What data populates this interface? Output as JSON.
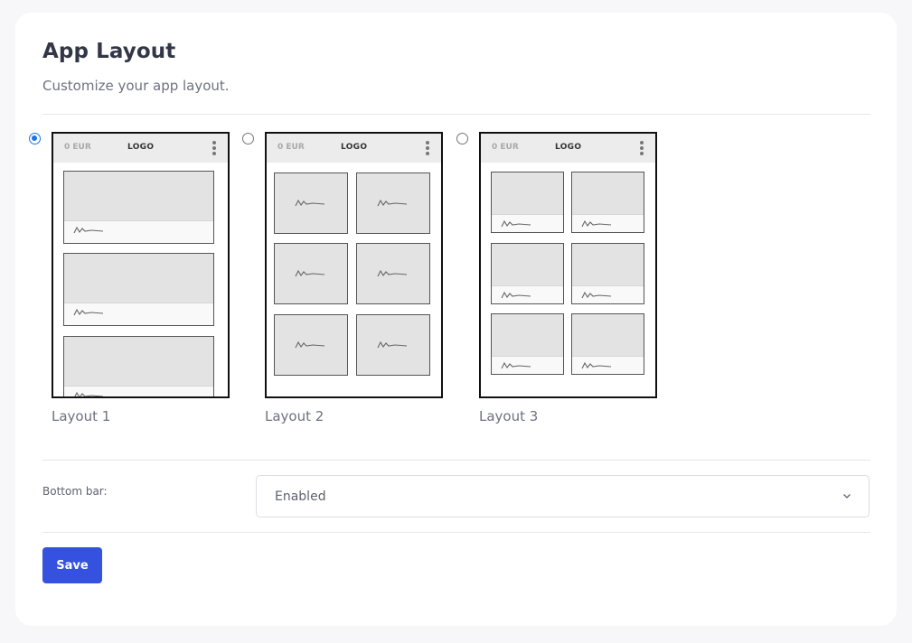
{
  "header": {
    "title": "App Layout",
    "subtitle": "Customize your app layout."
  },
  "layouts": [
    {
      "label": "Layout 1",
      "selected": true,
      "preview_currency": "0 EUR",
      "preview_logo": "LOGO"
    },
    {
      "label": "Layout 2",
      "selected": false,
      "preview_currency": "0 EUR",
      "preview_logo": "LOGO"
    },
    {
      "label": "Layout 3",
      "selected": false,
      "preview_currency": "0 EUR",
      "preview_logo": "LOGO"
    }
  ],
  "bottom_bar": {
    "label": "Bottom bar:",
    "value": "Enabled"
  },
  "actions": {
    "save_label": "Save"
  },
  "colors": {
    "accent": "#3551e0",
    "radio_checked": "#1a73e8",
    "background": "#f7f7f9",
    "card": "#ffffff"
  },
  "icons": {
    "dropdown": "chevron-down-icon",
    "preview_menu": "kebab-menu-icon",
    "preview_signature": "squiggle-icon"
  }
}
